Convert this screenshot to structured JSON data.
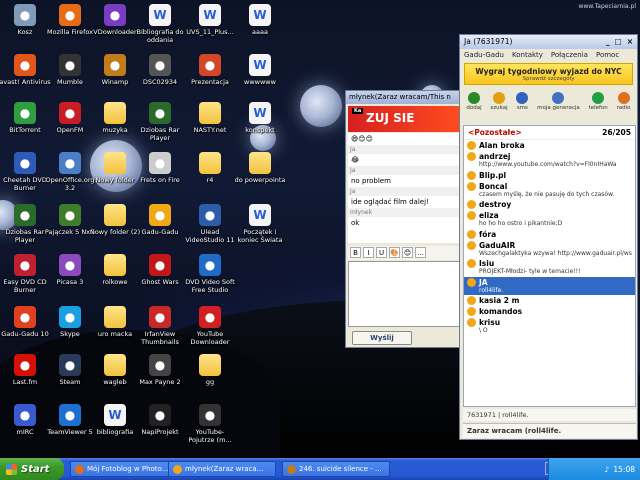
{
  "watermark": "www.Tapeciarnia.pl",
  "desktop_icons": [
    {
      "label": "Kosz",
      "icon": "recycle-bin-icon",
      "color": "#7f9bb8"
    },
    {
      "label": "Mozilla Firefox",
      "icon": "firefox-icon",
      "color": "#e66b18"
    },
    {
      "label": "VDownloader",
      "icon": "vdownloader-icon",
      "color": "#7a3cc2"
    },
    {
      "label": "Bibliografia do oddania",
      "icon": "word-doc-icon",
      "color": "doc"
    },
    {
      "label": "UVS_11_Plus...",
      "icon": "word-doc-icon",
      "color": "doc"
    },
    {
      "label": "aaaa",
      "icon": "word-doc-icon",
      "color": "doc"
    },
    {
      "label": "avast! Antivirus",
      "icon": "avast-icon",
      "color": "#e2561b"
    },
    {
      "label": "Mumble",
      "icon": "mumble-icon",
      "color": "#333333"
    },
    {
      "label": "Winamp",
      "icon": "winamp-icon",
      "color": "#c27d1a"
    },
    {
      "label": "DSC02934",
      "icon": "image-icon",
      "color": "#555555"
    },
    {
      "label": "Prezentacja",
      "icon": "presentation-icon",
      "color": "#d24726"
    },
    {
      "label": "wwwwww",
      "icon": "word-doc-icon",
      "color": "doc"
    },
    {
      "label": "BitTorrent",
      "icon": "bittorrent-icon",
      "color": "#2e9e3e"
    },
    {
      "label": "OpenFM",
      "icon": "openfm-icon",
      "color": "#c81d25"
    },
    {
      "label": "muzyka",
      "icon": "folder-icon",
      "color": "folder"
    },
    {
      "label": "Dziobas Rar Player",
      "icon": "rar-player-icon",
      "color": "#2a6a2a"
    },
    {
      "label": "NASTY.net",
      "icon": "folder-icon",
      "color": "folder"
    },
    {
      "label": "konspekt",
      "icon": "word-doc-icon",
      "color": "doc"
    },
    {
      "label": "Cheetah DVD Burner",
      "icon": "cheetah-icon",
      "color": "#2f5bb8"
    },
    {
      "label": "OpenOffice.org 3.2",
      "icon": "openoffice-icon",
      "color": "#4a7ec7"
    },
    {
      "label": "Nowy folder",
      "icon": "folder-icon",
      "color": "folder"
    },
    {
      "label": "Frets on Fire",
      "icon": "frets-icon",
      "color": "#cccccc"
    },
    {
      "label": "r4",
      "icon": "folder-icon",
      "color": "folder"
    },
    {
      "label": "do powerpointa",
      "icon": "folder-icon",
      "color": "folder"
    },
    {
      "label": "Dziobas Rar Player",
      "icon": "rar-player-icon",
      "color": "#2a6a2a"
    },
    {
      "label": "Pajączek 5 NxG",
      "icon": "pajaczek-icon",
      "color": "#3d7d2c"
    },
    {
      "label": "Nowy folder (2)",
      "icon": "folder-icon",
      "color": "folder"
    },
    {
      "label": "Gadu-Gadu",
      "icon": "gadu-gadu-icon",
      "color": "#f0a818"
    },
    {
      "label": "Ulead VideoStudio 11",
      "icon": "ulead-icon",
      "color": "#2d5da8"
    },
    {
      "label": "Początek i koniec Świata",
      "icon": "document-icon",
      "color": "doc"
    },
    {
      "label": "Easy DVD CD Burner",
      "icon": "easy-burner-icon",
      "color": "#c02030"
    },
    {
      "label": "Picasa 3",
      "icon": "picasa-icon",
      "color": "#8a4bbf"
    },
    {
      "label": "rolkowe",
      "icon": "folder-icon",
      "color": "folder"
    },
    {
      "label": "Ghost Wars",
      "icon": "game-icon",
      "color": "#c01818"
    },
    {
      "label": "DVD Video Soft Free Studio",
      "icon": "dvdvideosoft-icon",
      "color": "#1e6cc7"
    },
    {
      "label": "",
      "icon": "empty-slot",
      "color": "none"
    },
    {
      "label": "Gadu-Gadu 10",
      "icon": "gadu-gadu-icon",
      "color": "#e04020"
    },
    {
      "label": "Skype",
      "icon": "skype-icon",
      "color": "#1aa0e0"
    },
    {
      "label": "uro macka",
      "icon": "folder-icon",
      "color": "folder"
    },
    {
      "label": "IrfanView Thumbnails",
      "icon": "irfanview-icon",
      "color": "#c82828"
    },
    {
      "label": "YouTube Downloader",
      "icon": "youtube-downloader-icon",
      "color": "#d02020"
    },
    {
      "label": "",
      "icon": "empty-slot",
      "color": "none"
    },
    {
      "label": "Last.fm",
      "icon": "lastfm-icon",
      "color": "#d51007"
    },
    {
      "label": "Steam",
      "icon": "steam-icon",
      "color": "#2a3b5a"
    },
    {
      "label": "wagleb",
      "icon": "folder-icon",
      "color": "folder"
    },
    {
      "label": "Max Payne 2",
      "icon": "game-icon",
      "color": "#444444"
    },
    {
      "label": "gg",
      "icon": "folder-icon",
      "color": "folder"
    },
    {
      "label": "",
      "icon": "empty-slot",
      "color": "none"
    },
    {
      "label": "mIRC",
      "icon": "mirc-icon",
      "color": "#3a5ad0"
    },
    {
      "label": "TeamViewer 5",
      "icon": "teamviewer-icon",
      "color": "#1d6fd0"
    },
    {
      "label": "bibliografia",
      "icon": "word-doc-icon",
      "color": "doc"
    },
    {
      "label": "NapiProjekt",
      "icon": "napiprojekt-icon",
      "color": "#222222"
    },
    {
      "label": "YouTube-Pojutrze (m...",
      "icon": "video-icon",
      "color": "#333333"
    }
  ],
  "chat_window": {
    "title": "młynek(Zaraz wracam/This n",
    "banner": "ZUJ SIE",
    "banner_tag": "Ka",
    "messages": [
      {
        "from": "",
        "text": "😄😊😊"
      },
      {
        "from": "Ja",
        "text": "😂"
      },
      {
        "from": "Ja",
        "text": "no problem"
      },
      {
        "from": "Ja",
        "text": "ide oglądać film dalej!"
      },
      {
        "from": "młynek",
        "text": "ok"
      }
    ],
    "format_buttons": [
      "B",
      "I",
      "U",
      "🎨",
      "😊",
      "…"
    ],
    "send_label": "Wyślij"
  },
  "gg_window": {
    "title": "Ja (7631971)",
    "menu": [
      "Gadu-Gadu",
      "Kontakty",
      "Połączenia",
      "Pomoc"
    ],
    "promo_text": "Wygraj tygodniowy wyjazd do NYC",
    "promo_sub": "Sprawdź szczegóły",
    "tools": [
      {
        "label": "dodaj",
        "icon": "add-contact-icon",
        "color": "#2a8a2a"
      },
      {
        "label": "szukaj",
        "icon": "search-icon",
        "color": "#e0a010"
      },
      {
        "label": "sms",
        "icon": "sms-icon",
        "color": "#3060c0"
      },
      {
        "label": "moja generacja",
        "icon": "generation-icon",
        "color": "#4070c0"
      },
      {
        "label": "telefon",
        "icon": "phone-icon",
        "color": "#20a040"
      },
      {
        "label": "radio",
        "icon": "radio-icon",
        "color": "#e07020"
      }
    ],
    "group_name": "<Pozostałe>",
    "group_count": "26/205",
    "contacts": [
      {
        "name": "Alan broka",
        "desc": "",
        "status": "#f0a818",
        "selected": false
      },
      {
        "name": "andrzej",
        "desc": "http://www.youtube.com/watch?v=Fl0nIHaWa",
        "status": "#f0a818",
        "selected": false
      },
      {
        "name": "Blip.pl",
        "desc": "",
        "status": "#f0a818",
        "selected": false
      },
      {
        "name": "Boncal",
        "desc": "czasem myślę, że nie pasuję do tych czasów.",
        "status": "#f0a818",
        "selected": false
      },
      {
        "name": "destroy",
        "desc": "",
        "status": "#f0a818",
        "selected": false
      },
      {
        "name": "eliza",
        "desc": "ho ho ho ostro i pikantnie;D",
        "status": "#f0a818",
        "selected": false
      },
      {
        "name": "fóra",
        "desc": "",
        "status": "#f0a818",
        "selected": false
      },
      {
        "name": "GaduAIR",
        "desc": "Wszechgalaktyka wzywa! http://www.gaduair.pl/wszechdostepny/quiz",
        "status": "#f0a818",
        "selected": false
      },
      {
        "name": "Isiu",
        "desc": "PROJEKT-Młodzi- tyle w temacie!!!",
        "status": "#f0a818",
        "selected": false
      },
      {
        "name": "JA",
        "desc": "roll4life.",
        "status": "#f0a818",
        "selected": true
      },
      {
        "name": "kasia 2 m",
        "desc": "",
        "status": "#f0a818",
        "selected": false
      },
      {
        "name": "komandos",
        "desc": "",
        "status": "#f0a818",
        "selected": false
      },
      {
        "name": "krisu",
        "desc": "\\ O",
        "status": "#f0a818",
        "selected": false
      }
    ],
    "status_number": "7631971",
    "status_text": "roll4life.",
    "status_description": "Zaraz wracam (roll4life."
  },
  "taskbar": {
    "start_label": "Start",
    "tasks": [
      {
        "label": "Mój Fotoblog w Photo...",
        "icon_color": "#e66b18"
      },
      {
        "label": "młynek(Zaraz wraca...",
        "icon_color": "#f0a818"
      },
      {
        "label": "246. suicide silence - ...",
        "icon_color": "#c27d1a"
      }
    ],
    "language": "PL",
    "clock": "15:08"
  }
}
